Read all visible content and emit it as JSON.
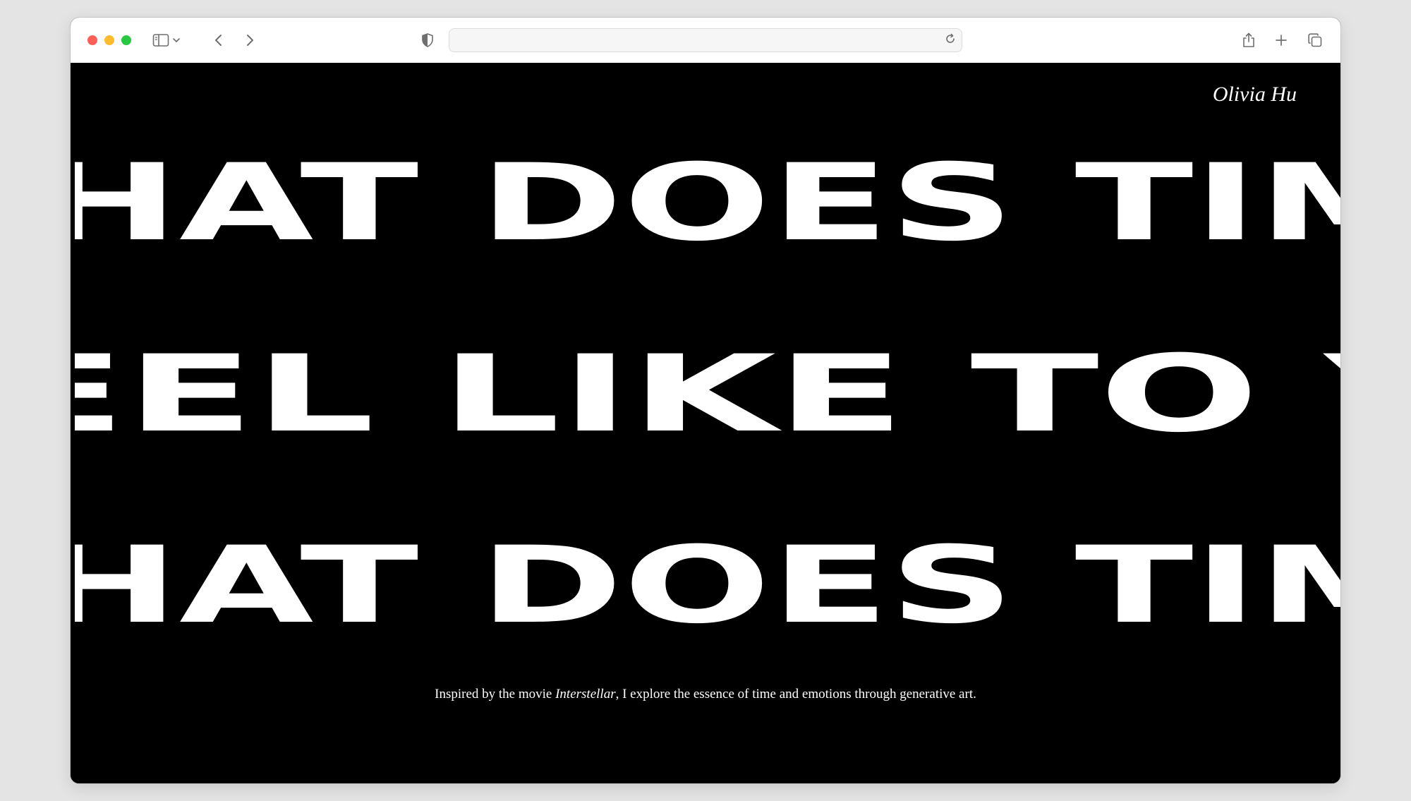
{
  "browser": {
    "traffic_lights": {
      "close": "#ff5f57",
      "minimize": "#febc2e",
      "zoom": "#28c840"
    },
    "icons": {
      "sidebar": "sidebar-icon",
      "sidebar_menu": "chevron-down-icon",
      "back": "chevron-left-icon",
      "forward": "chevron-right-icon",
      "privacy": "shield-icon",
      "reload": "reload-icon",
      "share": "share-icon",
      "new_tab": "plus-icon",
      "tabs": "tab-overview-icon"
    },
    "address": ""
  },
  "page": {
    "author": "Olivia Hu",
    "marquee_rows": [
      "HAT DOES TIM",
      "EEL LIKE TO Y",
      "HAT DOES TIM"
    ],
    "caption": {
      "before": "Inspired by the movie ",
      "title": "Interstellar",
      "after": ", I explore the essence of time and emotions through generative art."
    }
  }
}
